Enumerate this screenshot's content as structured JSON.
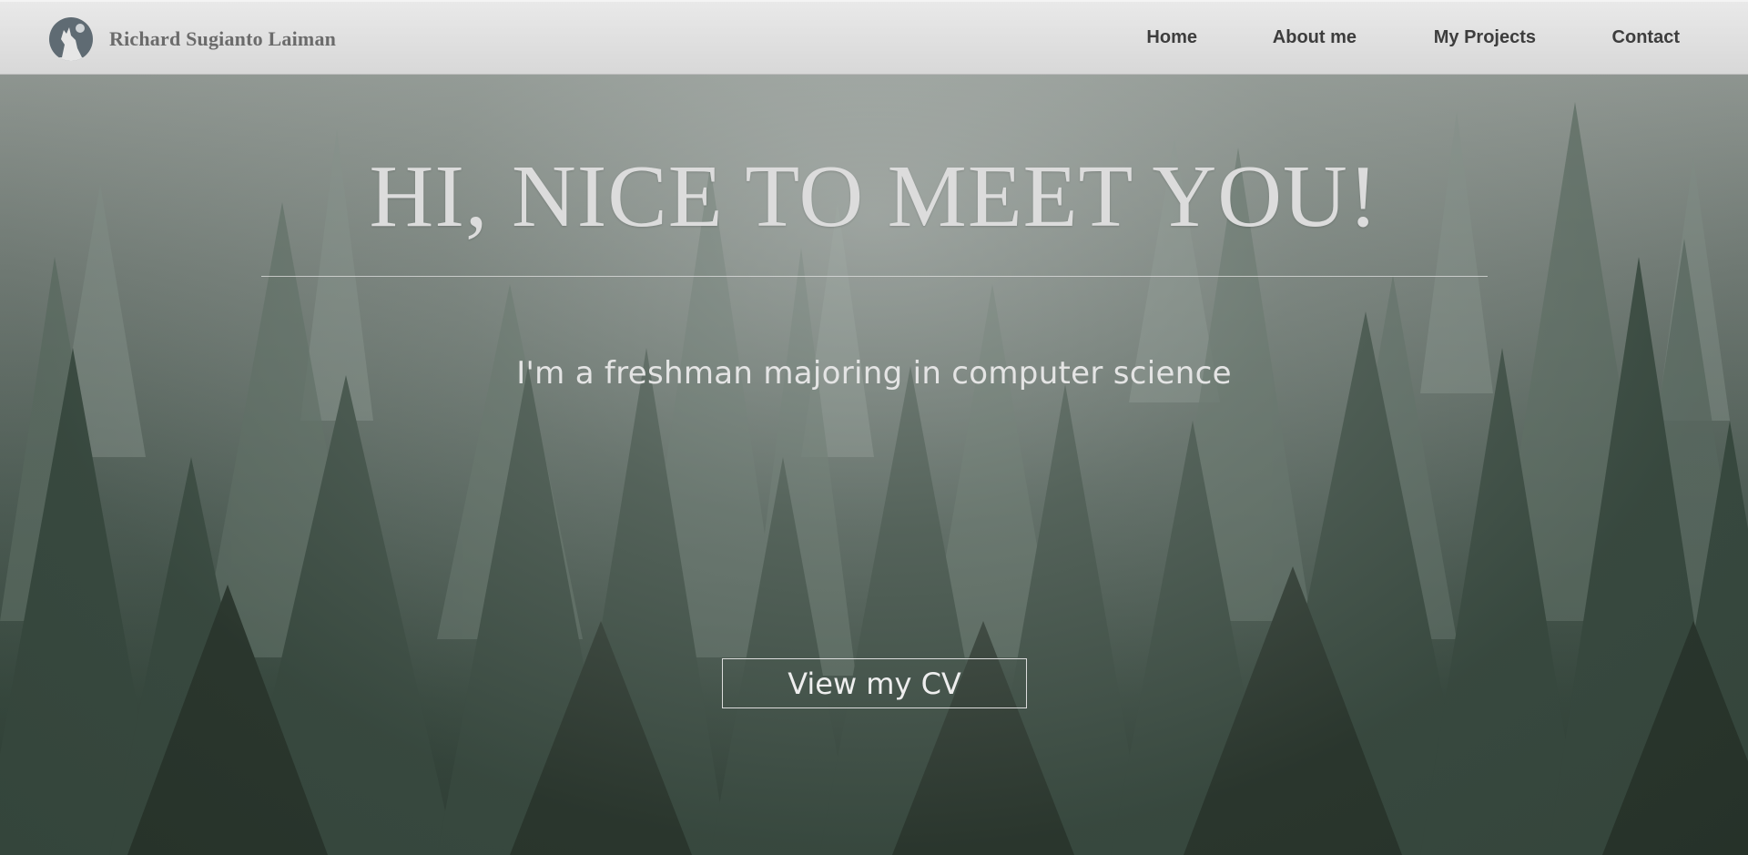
{
  "header": {
    "brand_name": "Richard Sugianto Laiman",
    "logo_icon": "wolf-howling-icon",
    "nav_items": [
      {
        "label": "Home"
      },
      {
        "label": "About me"
      },
      {
        "label": "My Projects"
      },
      {
        "label": "Contact"
      }
    ]
  },
  "hero": {
    "title": "HI, NICE TO MEET YOU!",
    "subtitle": "I'm a freshman majoring in computer science",
    "cv_button_label": "View my CV",
    "background": "misty-pine-forest-image"
  },
  "colors": {
    "navbar_bg": "#dcdcdc",
    "nav_text": "#3d3d3d",
    "brand_text": "#6b6b6b",
    "hero_text": "#dcdcdc",
    "forest_dark": "#2b3a31"
  }
}
